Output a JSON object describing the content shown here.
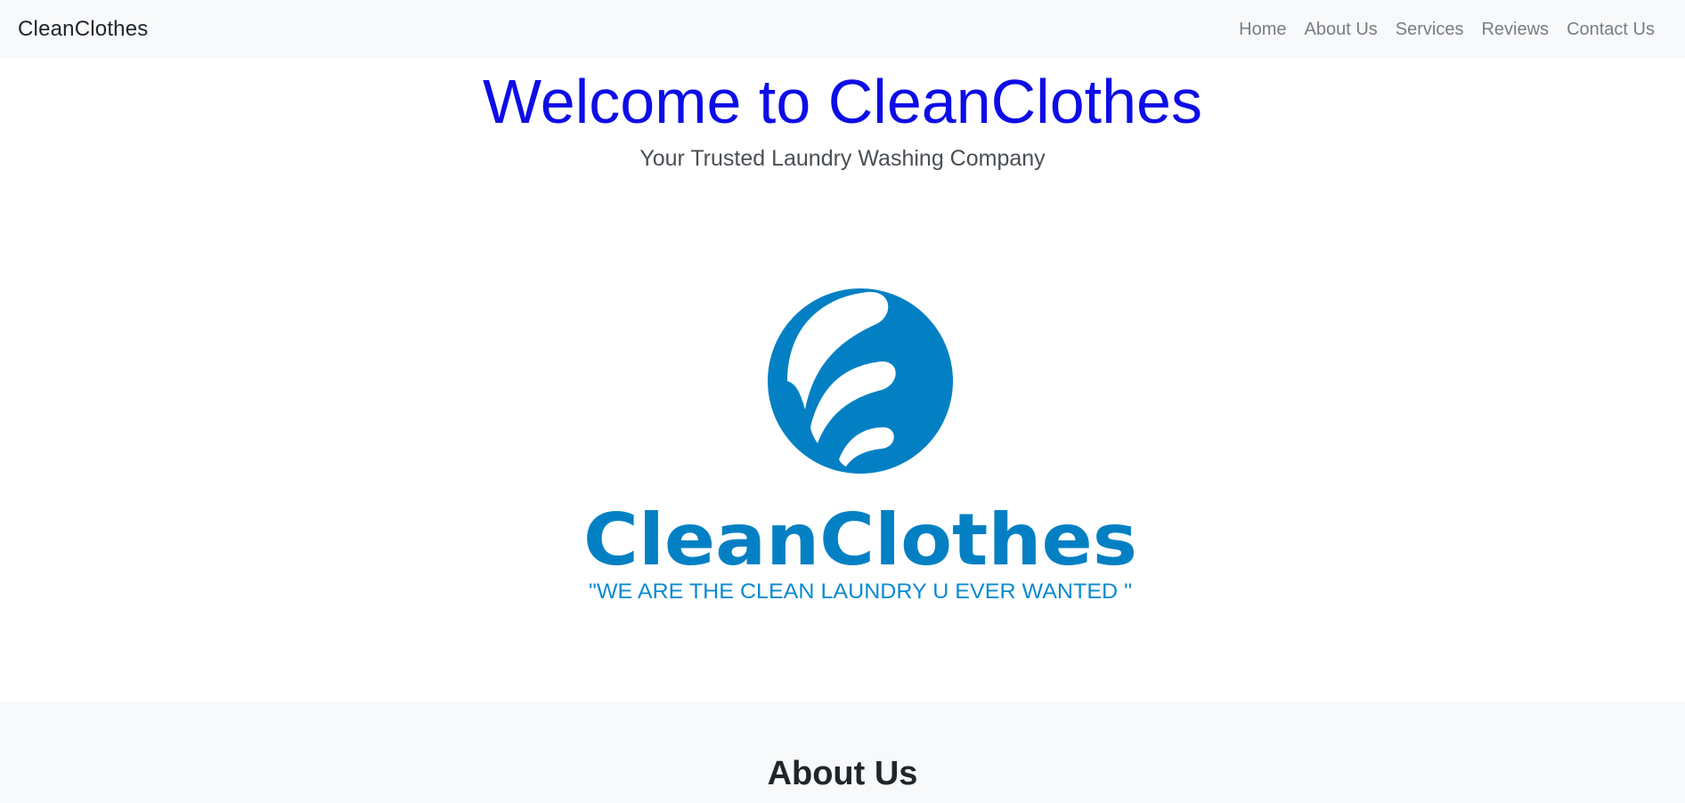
{
  "navbar": {
    "brand": "CleanClothes",
    "links": [
      {
        "label": "Home"
      },
      {
        "label": "About Us"
      },
      {
        "label": "Services"
      },
      {
        "label": "Reviews"
      },
      {
        "label": "Contact Us"
      }
    ]
  },
  "hero": {
    "title": "Welcome to CleanClothes",
    "subtitle": "Your Trusted Laundry Washing Company",
    "logo": {
      "wordmark": "CleanClothes",
      "tagline": "\"WE ARE THE CLEAN LAUNDRY U EVER WANTED \""
    }
  },
  "about": {
    "title": "About Us"
  },
  "colors": {
    "title_blue": "#0d0de6",
    "logo_blue": "#0380c4",
    "nav_bg": "#f8f9fa",
    "nav_link": "#7a7d80"
  }
}
